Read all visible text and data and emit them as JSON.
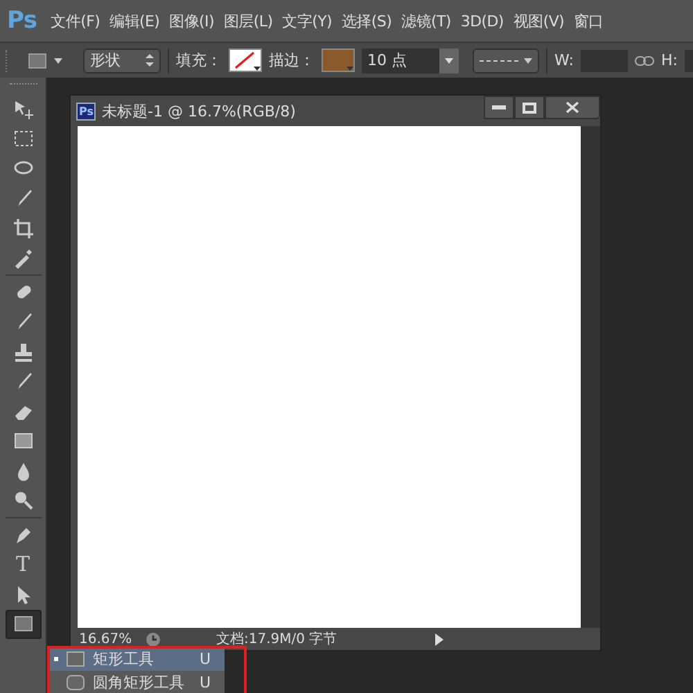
{
  "app_logo": "Ps",
  "menu": [
    "文件(F)",
    "编辑(E)",
    "图像(I)",
    "图层(L)",
    "文字(Y)",
    "选择(S)",
    "滤镜(T)",
    "3D(D)",
    "视图(V)",
    "窗口"
  ],
  "options_bar": {
    "mode": "形状",
    "fill_label": "填充：",
    "stroke_label": "描边：",
    "stroke_width": "10 点",
    "w_label": "W:",
    "h_label": "H:"
  },
  "tools": [
    {
      "selected": false
    },
    {
      "selected": false
    },
    {
      "selected": false
    },
    {
      "selected": false
    },
    {
      "selected": false
    },
    {
      "selected": false
    },
    {
      "selected": false
    },
    {
      "selected": false
    },
    {
      "selected": false
    },
    {
      "selected": false
    },
    {
      "selected": false
    },
    {
      "selected": false
    },
    {
      "selected": false
    },
    {
      "selected": false
    },
    {
      "selected": false
    },
    {
      "selected": false,
      "label": "T"
    },
    {
      "selected": false
    },
    {
      "selected": true
    }
  ],
  "document": {
    "title": "未标题-1 @ 16.7%(RGB/8)",
    "icon_text": "Ps",
    "zoom": "16.67%",
    "doc_info": "文档:17.9M/0 字节"
  },
  "flyout": [
    {
      "label": "矩形工具",
      "shortcut": "U",
      "selected": true
    },
    {
      "label": "圆角矩形工具",
      "shortcut": "U",
      "selected": false
    }
  ]
}
